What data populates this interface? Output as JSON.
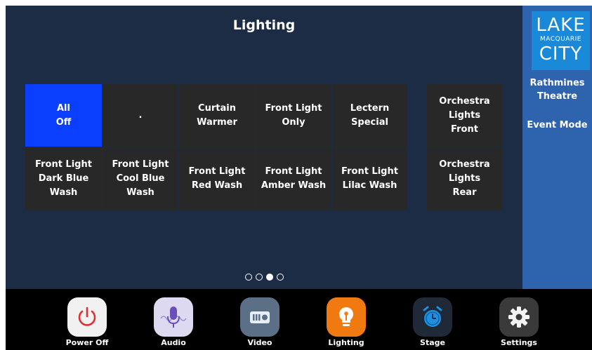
{
  "header": {
    "title": "Lighting"
  },
  "brand": {
    "line1": "LAKE",
    "line2": "MACQUARIE",
    "line3": "CITY"
  },
  "venue": {
    "line1": "Rathmines",
    "line2": "Theatre",
    "mode": "Event Mode"
  },
  "grid": [
    {
      "label": "All\nOff",
      "active": true
    },
    {
      "label": "."
    },
    {
      "label": "Curtain\nWarmer"
    },
    {
      "label": "Front Light\nOnly"
    },
    {
      "label": "Lectern\nSpecial"
    },
    {
      "label": "Front Light\nDark Blue\nWash"
    },
    {
      "label": "Front Light\nCool Blue\nWash"
    },
    {
      "label": "Front Light\nRed Wash"
    },
    {
      "label": "Front Light\nAmber Wash"
    },
    {
      "label": "Front Light\nLilac Wash"
    }
  ],
  "orchestra": [
    {
      "label": "Orchestra\nLights\nFront"
    },
    {
      "label": "Orchestra\nLights\nRear"
    }
  ],
  "pager": {
    "count": 4,
    "current": 3
  },
  "nav": [
    {
      "label": "Power Off",
      "icon": "power-icon"
    },
    {
      "label": "Audio",
      "icon": "microphone-icon"
    },
    {
      "label": "Video",
      "icon": "projector-icon"
    },
    {
      "label": "Lighting",
      "icon": "lightbulb-icon"
    },
    {
      "label": "Stage",
      "icon": "alarm-clock-icon"
    },
    {
      "label": "Settings",
      "icon": "gear-icon"
    }
  ],
  "colors": {
    "main_bg": "#1d2c45",
    "side_bg": "#2e63ae",
    "button_bg": "#282828",
    "active_button": "#0a3fff",
    "lighting_orange": "#f07a10"
  }
}
